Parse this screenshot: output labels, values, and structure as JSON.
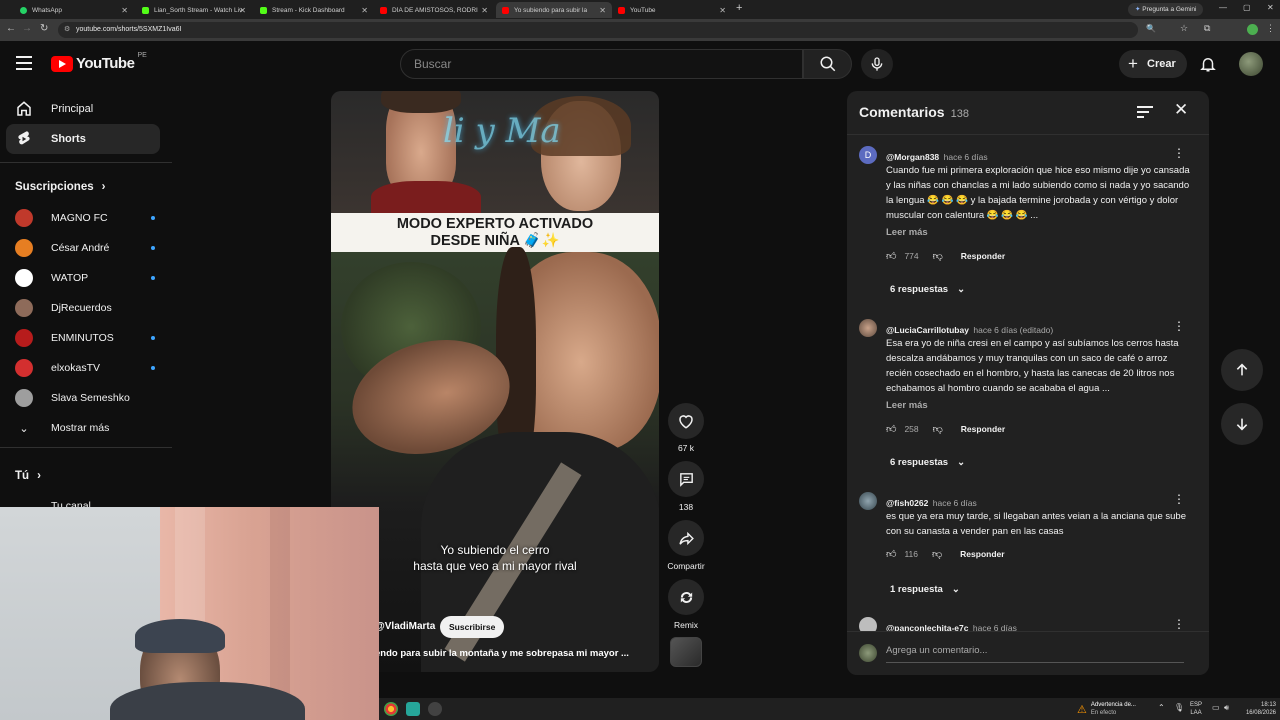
{
  "browser": {
    "tabs": [
      {
        "label": "WhatsApp",
        "color": "#25d366"
      },
      {
        "label": "Lian_Sorth Stream - Watch Live",
        "color": "#53fc18"
      },
      {
        "label": "Stream - Kick Dashboard",
        "color": "#53fc18"
      },
      {
        "label": "DÍA DE AMISTOSOS, RODRI",
        "color": "#ff0000"
      },
      {
        "label": "Yo subiendo para subir la",
        "color": "#ff0000"
      },
      {
        "label": "YouTube",
        "color": "#ff0000"
      }
    ],
    "gemini_label": "Pregunta a Gemini",
    "url": "youtube.com/shorts/5SXMZ1Iva6I"
  },
  "header": {
    "logo": "YouTube",
    "region": "PE",
    "search_placeholder": "Buscar",
    "create_label": "Crear"
  },
  "sidebar": {
    "main_items": [
      {
        "label": "Principal",
        "icon": "home-icon"
      },
      {
        "label": "Shorts",
        "icon": "shorts-icon"
      }
    ],
    "subscriptions_title": "Suscripciones",
    "subscriptions": [
      {
        "name": "MAGNO FC",
        "color": "#c0392b",
        "live": true
      },
      {
        "name": "César André",
        "color": "#e67e22",
        "live": true
      },
      {
        "name": "WATOP",
        "color": "#ffffff",
        "live": true
      },
      {
        "name": "DjRecuerdos",
        "color": "#8e6b5a",
        "live": false
      },
      {
        "name": "ENMINUTOS",
        "color": "#b71c1c",
        "live": true
      },
      {
        "name": "elxokasTV",
        "color": "#d32f2f",
        "live": true
      },
      {
        "name": "Slava Semeshko",
        "color": "#9e9e9e",
        "live": false
      }
    ],
    "show_more": "Mostrar más",
    "you_title": "Tú",
    "your_channel": "Tu canal"
  },
  "video": {
    "banner_line1": "MODO EXPERTO ACTIVADO",
    "banner_line2": "DESDE NIÑA 🧳✨",
    "caption_line1": "Yo subiendo el cerro",
    "caption_line2": "hasta que veo a mi mayor rival",
    "channel": "@VladiMarta",
    "subscribe": "Suscribirse",
    "title": "endo para subir la montaña y me sobrepasa mi mayor ..."
  },
  "actions": {
    "likes": "67 k",
    "comments": "138",
    "share": "Compartir",
    "remix": "Remix"
  },
  "comments_panel": {
    "title": "Comentarios",
    "count": "138",
    "items": [
      {
        "user": "@Morgan838",
        "time": "hace 6 días",
        "avatar_letter": "D",
        "avatar_color": "#5c6bc0",
        "text": "Cuando fue mi primera exploración que hice eso mismo dije yo cansada y las niñas con chanclas a mi lado subiendo como si nada y yo sacando la lengua 😂 😂 😂 y la bajada termine jorobada y con vértigo y dolor muscular con calentura 😂 😂 😂 ...",
        "read_more": "Leer más",
        "likes": "774",
        "reply": "Responder",
        "replies": "6 respuestas"
      },
      {
        "user": "@LuciaCarrillotubay",
        "time": "hace 6 días (editado)",
        "avatar_letter": "",
        "avatar_color": "#a1887f",
        "text": "Esa era yo de niña cresi en el campo y así subíamos los cerros hasta descalza andábamos y muy tranquilas con un saco de café o arroz recién cosechado en el hombro, y hasta las canecas de 20 litros nos echabamos al hombro cuando se acababa el agua ...",
        "read_more": "Leer más",
        "likes": "258",
        "reply": "Responder",
        "replies": "6 respuestas"
      },
      {
        "user": "@fish0262",
        "time": "hace 6 días",
        "avatar_letter": "",
        "avatar_color": "#546e7a",
        "text": "es que ya era muy tarde, si llegaban antes veian a la anciana que sube con su canasta a vender pan en las casas",
        "read_more": "",
        "likes": "116",
        "reply": "Responder",
        "replies": "1 respuesta"
      },
      {
        "user": "@panconlechita-e7c",
        "time": "hace 6 días",
        "avatar_letter": "",
        "avatar_color": "#bdbdbd"
      }
    ],
    "add_placeholder": "Agrega un comentario..."
  },
  "taskbar": {
    "warning_title": "Advertencia de...",
    "warning_sub": "En efecto",
    "lang": "ESP",
    "lang2": "LAA",
    "time": "18:13",
    "date": "16/08/2026"
  }
}
